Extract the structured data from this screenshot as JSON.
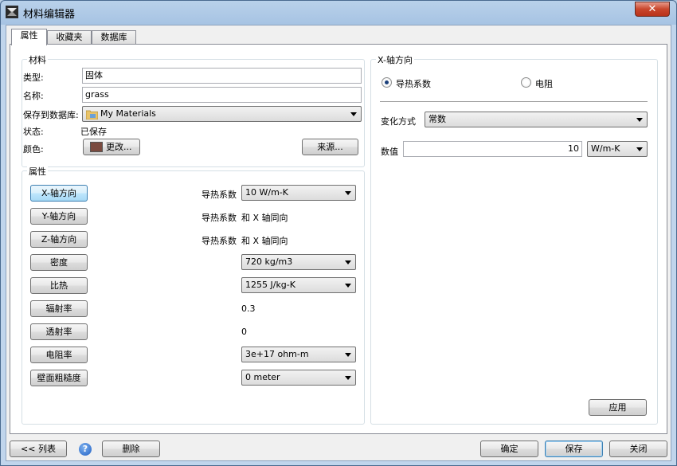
{
  "window": {
    "title": "材料编辑器",
    "close_glyph": "✕"
  },
  "tabs": [
    {
      "label": "属性",
      "active": true
    },
    {
      "label": "收藏夹",
      "active": false
    },
    {
      "label": "数据库",
      "active": false
    }
  ],
  "material": {
    "group_label": "材料",
    "type_label": "类型:",
    "type_value": "固体",
    "name_label": "名称:",
    "name_value": "grass",
    "save_label": "保存到数据库:",
    "save_value": "My Materials",
    "status_label": "状态:",
    "status_value": "已保存",
    "color_label": "颜色:",
    "color_hex": "#7a4a3f",
    "change_button": "更改...",
    "source_button": "来源..."
  },
  "properties": {
    "group_label": "属性",
    "rows": [
      {
        "button": "X-轴方向",
        "label": "导热系数",
        "value": "10 W/m-K",
        "kind": "combo",
        "selected": true
      },
      {
        "button": "Y-轴方向",
        "label": "导热系数",
        "value": "和 X 轴同向",
        "kind": "text"
      },
      {
        "button": "Z-轴方向",
        "label": "导热系数",
        "value": "和 X 轴同向",
        "kind": "text"
      },
      {
        "button": "密度",
        "label": "",
        "value": "720 kg/m3",
        "kind": "combo"
      },
      {
        "button": "比热",
        "label": "",
        "value": "1255 J/kg-K",
        "kind": "combo"
      },
      {
        "button": "辐射率",
        "label": "",
        "value": "0.3",
        "kind": "text"
      },
      {
        "button": "透射率",
        "label": "",
        "value": "0",
        "kind": "text"
      },
      {
        "button": "电阻率",
        "label": "",
        "value": "3e+17 ohm-m",
        "kind": "combo"
      },
      {
        "button": "壁面粗糙度",
        "label": "",
        "value": "0 meter",
        "kind": "combo"
      }
    ]
  },
  "xaxis_panel": {
    "group_label": "X-轴方向",
    "radio_conductivity": "导热系数",
    "radio_resistance": "电阻",
    "variation_label": "变化方式",
    "variation_value": "常数",
    "value_label": "数值",
    "value": "10",
    "unit": "W/m-K",
    "apply_button": "应用"
  },
  "footer": {
    "list_button": "<< 列表",
    "help_glyph": "?",
    "delete_button": "删除",
    "ok_button": "确定",
    "save_button": "保存",
    "close_button": "关闭"
  }
}
